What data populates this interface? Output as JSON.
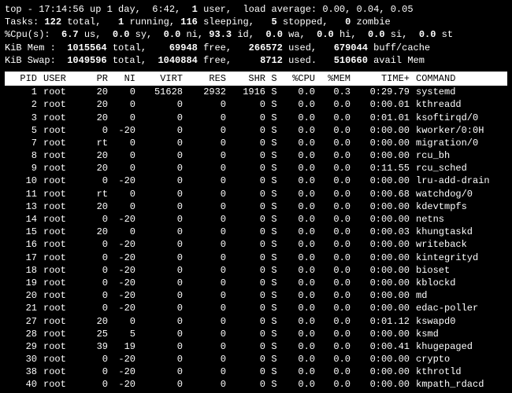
{
  "summary": {
    "line1": {
      "prefix": "top - ",
      "time": "17:14:56",
      "up_label": " up ",
      "uptime": "1 day,  6:42,",
      "users": "  1",
      "users_label": " user,  load average: ",
      "load": "0.00, 0.04, 0.05"
    },
    "line2": {
      "label": "Tasks:",
      "total": " 122 ",
      "total_l": "total,   ",
      "running": "1 ",
      "running_l": "running, ",
      "sleeping": "116 ",
      "sleeping_l": "sleeping,   ",
      "stopped": "5 ",
      "stopped_l": "stopped,   ",
      "zombie": "0 ",
      "zombie_l": "zombie"
    },
    "line3": {
      "label": "%Cpu(s):  ",
      "us": "6.7 ",
      "us_l": "us,  ",
      "sy": "0.0 ",
      "sy_l": "sy,  ",
      "ni": "0.0 ",
      "ni_l": "ni, ",
      "id": "93.3 ",
      "id_l": "id,  ",
      "wa": "0.0 ",
      "wa_l": "wa,  ",
      "hi": "0.0 ",
      "hi_l": "hi,  ",
      "si": "0.0 ",
      "si_l": "si,  ",
      "st": "0.0 ",
      "st_l": "st"
    },
    "line4": {
      "label": "KiB Mem :  ",
      "total": "1015564 ",
      "total_l": "total,    ",
      "free": "69948 ",
      "free_l": "free,   ",
      "used": "266572 ",
      "used_l": "used,   ",
      "buff": "679044 ",
      "buff_l": "buff/cache"
    },
    "line5": {
      "label": "KiB Swap:  ",
      "total": "1049596 ",
      "total_l": "total,  ",
      "free": "1040884 ",
      "free_l": "free,     ",
      "used": "8712 ",
      "used_l": "used.   ",
      "avail": "510660 ",
      "avail_l": "avail Mem"
    }
  },
  "columns": {
    "pid": "PID",
    "user": "USER",
    "pr": "PR",
    "ni": "NI",
    "virt": "VIRT",
    "res": "RES",
    "shr": "SHR",
    "s": "S",
    "cpu": "%CPU",
    "mem": "%MEM",
    "time": "TIME+",
    "cmd": "COMMAND"
  },
  "rows": [
    {
      "pid": "1",
      "user": "root",
      "pr": "20",
      "ni": "0",
      "virt": "51628",
      "res": "2932",
      "shr": "1916",
      "s": "S",
      "cpu": "0.0",
      "mem": "0.3",
      "time": "0:29.79",
      "cmd": "systemd"
    },
    {
      "pid": "2",
      "user": "root",
      "pr": "20",
      "ni": "0",
      "virt": "0",
      "res": "0",
      "shr": "0",
      "s": "S",
      "cpu": "0.0",
      "mem": "0.0",
      "time": "0:00.01",
      "cmd": "kthreadd"
    },
    {
      "pid": "3",
      "user": "root",
      "pr": "20",
      "ni": "0",
      "virt": "0",
      "res": "0",
      "shr": "0",
      "s": "S",
      "cpu": "0.0",
      "mem": "0.0",
      "time": "0:01.01",
      "cmd": "ksoftirqd/0"
    },
    {
      "pid": "5",
      "user": "root",
      "pr": "0",
      "ni": "-20",
      "virt": "0",
      "res": "0",
      "shr": "0",
      "s": "S",
      "cpu": "0.0",
      "mem": "0.0",
      "time": "0:00.00",
      "cmd": "kworker/0:0H"
    },
    {
      "pid": "7",
      "user": "root",
      "pr": "rt",
      "ni": "0",
      "virt": "0",
      "res": "0",
      "shr": "0",
      "s": "S",
      "cpu": "0.0",
      "mem": "0.0",
      "time": "0:00.00",
      "cmd": "migration/0"
    },
    {
      "pid": "8",
      "user": "root",
      "pr": "20",
      "ni": "0",
      "virt": "0",
      "res": "0",
      "shr": "0",
      "s": "S",
      "cpu": "0.0",
      "mem": "0.0",
      "time": "0:00.00",
      "cmd": "rcu_bh"
    },
    {
      "pid": "9",
      "user": "root",
      "pr": "20",
      "ni": "0",
      "virt": "0",
      "res": "0",
      "shr": "0",
      "s": "S",
      "cpu": "0.0",
      "mem": "0.0",
      "time": "0:11.55",
      "cmd": "rcu_sched"
    },
    {
      "pid": "10",
      "user": "root",
      "pr": "0",
      "ni": "-20",
      "virt": "0",
      "res": "0",
      "shr": "0",
      "s": "S",
      "cpu": "0.0",
      "mem": "0.0",
      "time": "0:00.00",
      "cmd": "lru-add-drain"
    },
    {
      "pid": "11",
      "user": "root",
      "pr": "rt",
      "ni": "0",
      "virt": "0",
      "res": "0",
      "shr": "0",
      "s": "S",
      "cpu": "0.0",
      "mem": "0.0",
      "time": "0:00.68",
      "cmd": "watchdog/0"
    },
    {
      "pid": "13",
      "user": "root",
      "pr": "20",
      "ni": "0",
      "virt": "0",
      "res": "0",
      "shr": "0",
      "s": "S",
      "cpu": "0.0",
      "mem": "0.0",
      "time": "0:00.00",
      "cmd": "kdevtmpfs"
    },
    {
      "pid": "14",
      "user": "root",
      "pr": "0",
      "ni": "-20",
      "virt": "0",
      "res": "0",
      "shr": "0",
      "s": "S",
      "cpu": "0.0",
      "mem": "0.0",
      "time": "0:00.00",
      "cmd": "netns"
    },
    {
      "pid": "15",
      "user": "root",
      "pr": "20",
      "ni": "0",
      "virt": "0",
      "res": "0",
      "shr": "0",
      "s": "S",
      "cpu": "0.0",
      "mem": "0.0",
      "time": "0:00.03",
      "cmd": "khungtaskd"
    },
    {
      "pid": "16",
      "user": "root",
      "pr": "0",
      "ni": "-20",
      "virt": "0",
      "res": "0",
      "shr": "0",
      "s": "S",
      "cpu": "0.0",
      "mem": "0.0",
      "time": "0:00.00",
      "cmd": "writeback"
    },
    {
      "pid": "17",
      "user": "root",
      "pr": "0",
      "ni": "-20",
      "virt": "0",
      "res": "0",
      "shr": "0",
      "s": "S",
      "cpu": "0.0",
      "mem": "0.0",
      "time": "0:00.00",
      "cmd": "kintegrityd"
    },
    {
      "pid": "18",
      "user": "root",
      "pr": "0",
      "ni": "-20",
      "virt": "0",
      "res": "0",
      "shr": "0",
      "s": "S",
      "cpu": "0.0",
      "mem": "0.0",
      "time": "0:00.00",
      "cmd": "bioset"
    },
    {
      "pid": "19",
      "user": "root",
      "pr": "0",
      "ni": "-20",
      "virt": "0",
      "res": "0",
      "shr": "0",
      "s": "S",
      "cpu": "0.0",
      "mem": "0.0",
      "time": "0:00.00",
      "cmd": "kblockd"
    },
    {
      "pid": "20",
      "user": "root",
      "pr": "0",
      "ni": "-20",
      "virt": "0",
      "res": "0",
      "shr": "0",
      "s": "S",
      "cpu": "0.0",
      "mem": "0.0",
      "time": "0:00.00",
      "cmd": "md"
    },
    {
      "pid": "21",
      "user": "root",
      "pr": "0",
      "ni": "-20",
      "virt": "0",
      "res": "0",
      "shr": "0",
      "s": "S",
      "cpu": "0.0",
      "mem": "0.0",
      "time": "0:00.00",
      "cmd": "edac-poller"
    },
    {
      "pid": "27",
      "user": "root",
      "pr": "20",
      "ni": "0",
      "virt": "0",
      "res": "0",
      "shr": "0",
      "s": "S",
      "cpu": "0.0",
      "mem": "0.0",
      "time": "0:01.12",
      "cmd": "kswapd0"
    },
    {
      "pid": "28",
      "user": "root",
      "pr": "25",
      "ni": "5",
      "virt": "0",
      "res": "0",
      "shr": "0",
      "s": "S",
      "cpu": "0.0",
      "mem": "0.0",
      "time": "0:00.00",
      "cmd": "ksmd"
    },
    {
      "pid": "29",
      "user": "root",
      "pr": "39",
      "ni": "19",
      "virt": "0",
      "res": "0",
      "shr": "0",
      "s": "S",
      "cpu": "0.0",
      "mem": "0.0",
      "time": "0:00.41",
      "cmd": "khugepaged"
    },
    {
      "pid": "30",
      "user": "root",
      "pr": "0",
      "ni": "-20",
      "virt": "0",
      "res": "0",
      "shr": "0",
      "s": "S",
      "cpu": "0.0",
      "mem": "0.0",
      "time": "0:00.00",
      "cmd": "crypto"
    },
    {
      "pid": "38",
      "user": "root",
      "pr": "0",
      "ni": "-20",
      "virt": "0",
      "res": "0",
      "shr": "0",
      "s": "S",
      "cpu": "0.0",
      "mem": "0.0",
      "time": "0:00.00",
      "cmd": "kthrotld"
    },
    {
      "pid": "40",
      "user": "root",
      "pr": "0",
      "ni": "-20",
      "virt": "0",
      "res": "0",
      "shr": "0",
      "s": "S",
      "cpu": "0.0",
      "mem": "0.0",
      "time": "0:00.00",
      "cmd": "kmpath_rdacd"
    }
  ]
}
